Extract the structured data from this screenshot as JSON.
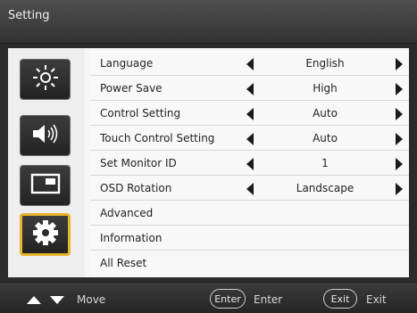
{
  "window": {
    "title": "Setting"
  },
  "sidebar": {
    "items": [
      {
        "icon": "brightness-icon",
        "active": false
      },
      {
        "icon": "speaker-icon",
        "active": false
      },
      {
        "icon": "display-window-icon",
        "active": false
      },
      {
        "icon": "gear-icon",
        "active": true
      }
    ]
  },
  "menu": {
    "rows": [
      {
        "label": "Language",
        "value": "English"
      },
      {
        "label": "Power Save",
        "value": "High"
      },
      {
        "label": "Control Setting",
        "value": "Auto"
      },
      {
        "label": "Touch Control Setting",
        "value": "Auto"
      },
      {
        "label": "Set Monitor ID",
        "value": "1"
      },
      {
        "label": "OSD Rotation",
        "value": "Landscape"
      },
      {
        "label": "Advanced"
      },
      {
        "label": "Information"
      },
      {
        "label": "All Reset"
      }
    ]
  },
  "footer": {
    "move_label": "Move",
    "enter_button": "Enter",
    "enter_label": "Enter",
    "exit_button": "Exit",
    "exit_label": "Exit"
  },
  "colors": {
    "accent": "#e6b52a",
    "panel": "#f8f8f8",
    "chrome": "#2b2b2b"
  }
}
